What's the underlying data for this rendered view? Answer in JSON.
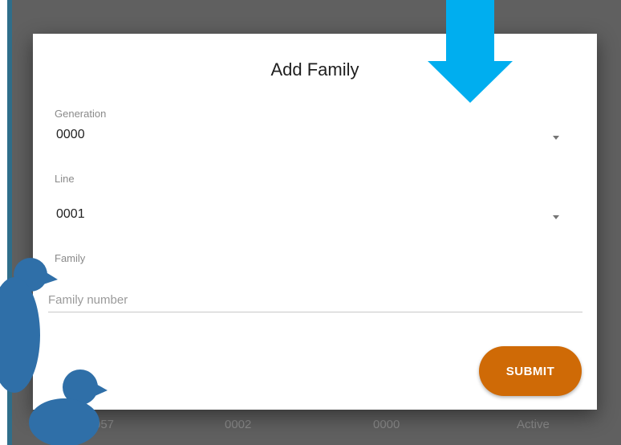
{
  "background_table": {
    "row": [
      "057",
      "0002",
      "0000",
      "Active"
    ]
  },
  "dialog": {
    "title": "Add Family",
    "generation": {
      "label": "Generation",
      "value": "0000"
    },
    "line": {
      "label": "Line",
      "value": "0001"
    },
    "family": {
      "label": "Family",
      "placeholder": "Family number"
    },
    "submit_label": "SUBMIT"
  },
  "icons": {
    "arrow": "arrow-down-icon",
    "dropdown": "chevron-down-icon",
    "mascot": "bird-icon"
  },
  "colors": {
    "submit": "#cf6a06",
    "arrow": "#00aeef",
    "mascot": "#2f6fa8"
  }
}
